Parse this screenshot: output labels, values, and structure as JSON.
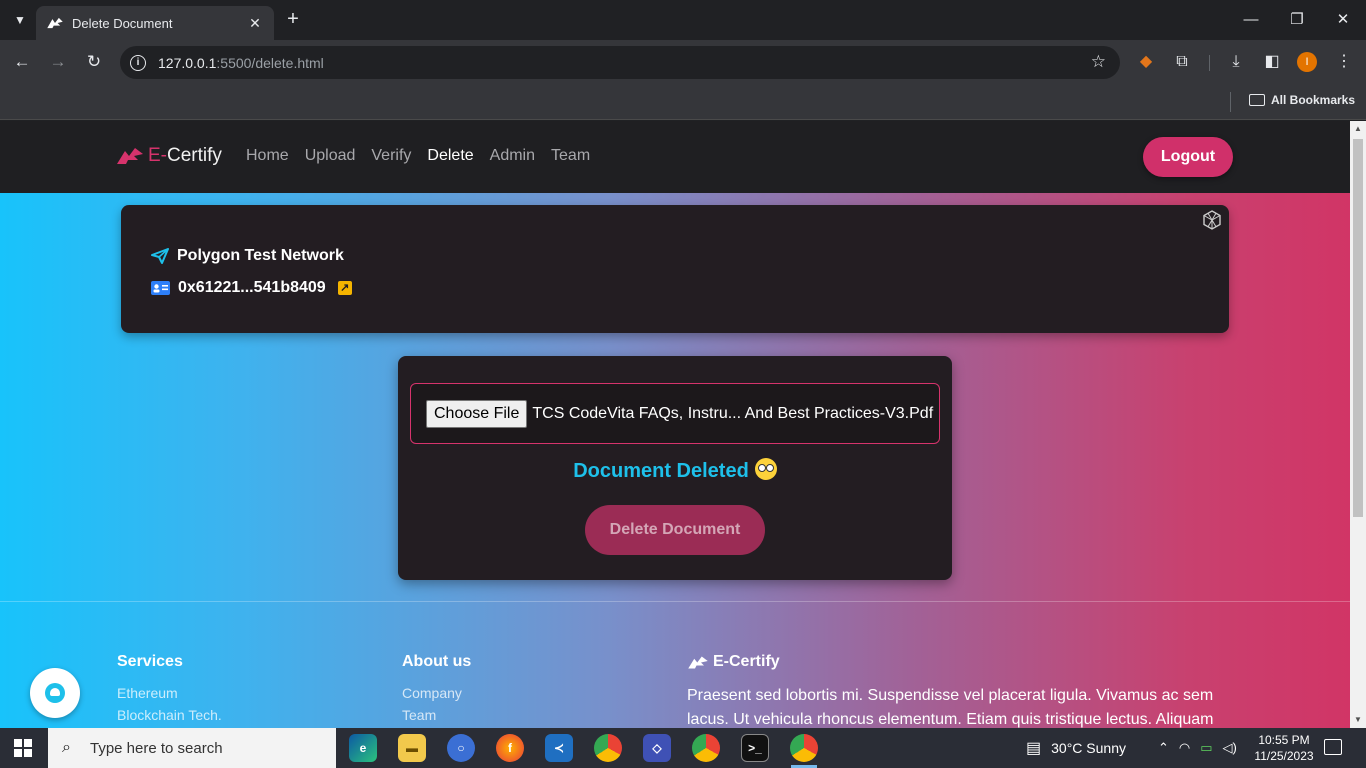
{
  "browser": {
    "tab_title": "Delete Document",
    "url_host": "127.0.0.1",
    "url_rest": ":5500/delete.html",
    "bookmarks_label": "All Bookmarks",
    "profile_initial": "I"
  },
  "site": {
    "brand_prefix": "E-",
    "brand_suffix": "Certify",
    "nav": [
      "Home",
      "Upload",
      "Verify",
      "Delete",
      "Admin",
      "Team"
    ],
    "active_nav": "Delete",
    "logout_label": "Logout",
    "accent_color": "#d0306a"
  },
  "network": {
    "name": "Polygon Test Network",
    "address": "0x61221...541b8409"
  },
  "delete_form": {
    "choose_file_label": "Choose File",
    "file_name": "TCS CodeVita FAQs, Instru... And Best Practices-V3.Pdf",
    "status_text": "Document Deleted",
    "delete_button_label": "Delete Document"
  },
  "footer": {
    "services_title": "Services",
    "services_links": [
      "Ethereum",
      "Blockchain Tech."
    ],
    "about_title": "About us",
    "about_links": [
      "Company",
      "Team"
    ],
    "brand_title": "E-Certify",
    "brand_text": "Praesent sed lobortis mi. Suspendisse vel placerat ligula. Vivamus ac sem lacus. Ut vehicula rhoncus elementum. Etiam quis tristique lectus. Aliquam"
  },
  "taskbar": {
    "search_placeholder": "Type here to search",
    "weather": "30°C  Sunny",
    "time": "10:55 PM",
    "date": "11/25/2023"
  }
}
